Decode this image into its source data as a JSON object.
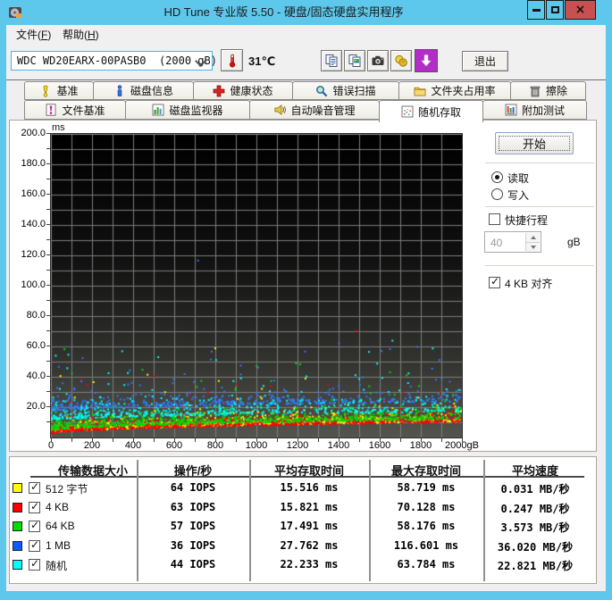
{
  "window": {
    "title": "HD Tune 专业版 5.50 - 硬盘/固态硬盘实用程序"
  },
  "menu": {
    "items": [
      {
        "id": "file",
        "pre": "文件(",
        "key": "F",
        "post": ")"
      },
      {
        "id": "help",
        "pre": "帮助(",
        "key": "H",
        "post": ")"
      }
    ]
  },
  "toolbar": {
    "drive_select": {
      "value": "WDC WD20EARX-00PASB0  (2000 gB)"
    },
    "temperature": "31℃",
    "buttons": [
      {
        "name": "copy-text-button",
        "icon": "copy-text-icon"
      },
      {
        "name": "copy-image-button",
        "icon": "copy-image-icon"
      },
      {
        "name": "screenshot-button",
        "icon": "screenshot-icon"
      },
      {
        "name": "coins-button",
        "icon": "coins-icon"
      },
      {
        "name": "update-button",
        "icon": "update-arrow-icon",
        "accent": "#B42CC8"
      }
    ],
    "exit_label": "退出"
  },
  "tabs": {
    "row1": [
      {
        "label": "基准",
        "icon": "benchmark-icon"
      },
      {
        "label": "磁盘信息",
        "icon": "disk-info-icon"
      },
      {
        "label": "健康状态",
        "icon": "health-icon"
      },
      {
        "label": "错误扫描",
        "icon": "error-scan-icon"
      },
      {
        "label": "文件夹占用率",
        "icon": "folder-usage-icon"
      },
      {
        "label": "擦除",
        "icon": "erase-icon"
      }
    ],
    "row2": [
      {
        "label": "文件基准",
        "icon": "file-benchmark-icon"
      },
      {
        "label": "磁盘监视器",
        "icon": "disk-monitor-icon"
      },
      {
        "label": "自动噪音管理",
        "icon": "aam-icon"
      },
      {
        "label": "随机存取",
        "icon": "random-access-icon",
        "active": true
      },
      {
        "label": "附加测试",
        "icon": "extra-tests-icon"
      }
    ],
    "active_label": "随机存取"
  },
  "controls": {
    "start_label": "开始",
    "mode": {
      "options": [
        {
          "label": "读取",
          "selected": true
        },
        {
          "label": "写入",
          "selected": false
        }
      ]
    },
    "short_stroke": {
      "label": "快捷行程",
      "checked": false,
      "value": "40",
      "unit": "gB",
      "enabled": false
    },
    "align_4kb": {
      "label": "4 KB 对齐",
      "checked": true
    }
  },
  "chart_data": {
    "type": "scatter",
    "ylabel_unit": "ms",
    "xlabel_unit": "gB",
    "xlim": [
      0,
      2000
    ],
    "ylim": [
      0,
      200
    ],
    "x_ticks": [
      0,
      200,
      400,
      600,
      800,
      1000,
      1200,
      1400,
      1600,
      1800,
      2000
    ],
    "x_tick_suffix_last": "gB",
    "y_ticks": [
      200,
      180,
      160,
      140,
      120,
      100,
      80,
      60,
      40,
      20
    ],
    "x_grid_step": 100,
    "y_grid_step": 10,
    "grid": true,
    "colors": {
      "background_top": "#000000",
      "background_bottom": "#55554f",
      "grid": "#7d7d7d"
    },
    "seed": 20,
    "series": [
      {
        "name": "512 字节",
        "color": "#ffff00",
        "points_est": 850,
        "base_ms_start": 2.6,
        "base_ms_end": 10.5,
        "spread_ms": 3.8,
        "tail_p": 0.02,
        "tail_max_ms": 38,
        "max_point": {
          "x_gb": 800,
          "y_ms": 58.719
        },
        "avg_ms": 15.516,
        "iops": 64
      },
      {
        "name": "4 KB",
        "color": "#ff0000",
        "points_est": 850,
        "base_ms_start": 2.3,
        "base_ms_end": 10.0,
        "spread_ms": 3.6,
        "tail_p": 0.02,
        "tail_max_ms": 35,
        "max_point": {
          "x_gb": 1486,
          "y_ms": 70.128
        },
        "avg_ms": 15.821,
        "iops": 63
      },
      {
        "name": "64 KB",
        "color": "#00dc00",
        "points_est": 850,
        "base_ms_start": 4.2,
        "base_ms_end": 12.0,
        "spread_ms": 4.2,
        "tail_p": 0.025,
        "tail_max_ms": 42,
        "max_point": {
          "x_gb": 66,
          "y_ms": 58.176
        },
        "avg_ms": 17.491,
        "iops": 57
      },
      {
        "name": "1 MB",
        "color": "#2e7cff",
        "points_est": 520,
        "base_ms_start": 17.0,
        "base_ms_end": 23.5,
        "spread_ms": 4.2,
        "tail_p": 0.06,
        "tail_max_ms": 40,
        "max_point": {
          "x_gb": 716,
          "y_ms": 116.601
        },
        "avg_ms": 27.762,
        "iops": 36
      },
      {
        "name": "随机",
        "color": "#00ffff",
        "points_est": 520,
        "base_ms_start": 11.0,
        "base_ms_end": 17.0,
        "spread_ms": 5.0,
        "tail_p": 0.05,
        "tail_max_ms": 45,
        "max_point": {
          "x_gb": 1662,
          "y_ms": 63.784
        },
        "avg_ms": 22.233,
        "iops": 44
      }
    ]
  },
  "results_table": {
    "columns": [
      "传输数据大小",
      "操作/秒",
      "平均存取时间",
      "最大存取时间",
      "平均速度"
    ],
    "rows": [
      {
        "color": "#ffff00",
        "checked": true,
        "label": "512 字节",
        "values": [
          "64 IOPS",
          "15.516 ms",
          "58.719 ms",
          "0.031 MB/秒"
        ]
      },
      {
        "color": "#ff0000",
        "checked": true,
        "label": "4 KB",
        "values": [
          "63 IOPS",
          "15.821 ms",
          "70.128 ms",
          "0.247 MB/秒"
        ]
      },
      {
        "color": "#00dc00",
        "checked": true,
        "label": "64 KB",
        "values": [
          "57 IOPS",
          "17.491 ms",
          "58.176 ms",
          "3.573 MB/秒"
        ]
      },
      {
        "color": "#0a5cff",
        "checked": true,
        "label": "1 MB",
        "values": [
          "36 IOPS",
          "27.762 ms",
          "116.601 ms",
          "36.020 MB/秒"
        ]
      },
      {
        "color": "#00ffff",
        "checked": true,
        "label": "随机",
        "values": [
          "44 IOPS",
          "22.233 ms",
          "63.784 ms",
          "22.821 MB/秒"
        ]
      }
    ]
  }
}
